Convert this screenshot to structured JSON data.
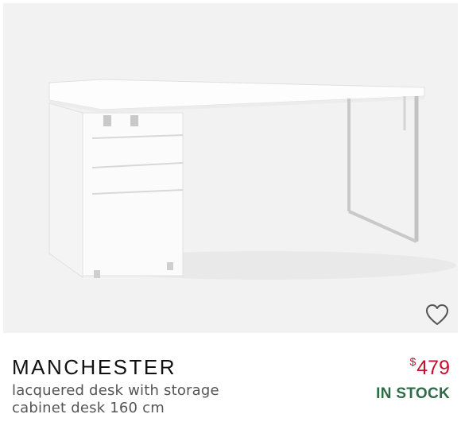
{
  "product": {
    "name": "MANCHESTER",
    "description": "lacquered desk with storage cabinet desk 160 cm",
    "price_currency": "$",
    "price_value": "479",
    "stock_status": "IN STOCK",
    "image_icon": "desk-product-image"
  },
  "wishlist": {
    "icon": "heart-outline-icon"
  },
  "colors": {
    "price": "#c8102e",
    "stock": "#2e6b46",
    "image_bg": "#f2f2f2"
  }
}
